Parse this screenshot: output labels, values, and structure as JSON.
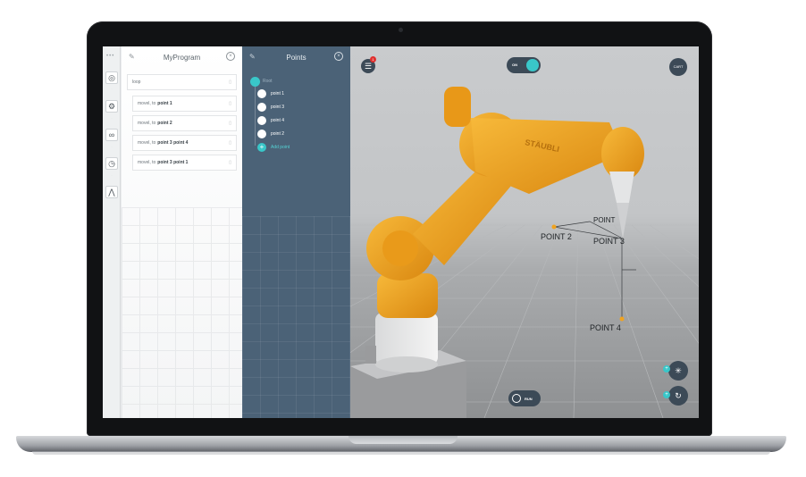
{
  "program": {
    "title": "MyProgram",
    "loop_label": "loop",
    "rows": [
      {
        "prefix": "movel, to",
        "target": "point 1"
      },
      {
        "prefix": "movel, to",
        "target": "point 2"
      },
      {
        "prefix": "movel, to",
        "target": "point 3 point 4"
      },
      {
        "prefix": "movel, to",
        "target": "point 3 point 1"
      }
    ]
  },
  "points_panel": {
    "title": "Points",
    "root_label": "Root",
    "items": [
      "point 1",
      "point 3",
      "point 4",
      "point 2"
    ],
    "add_label": "Add point"
  },
  "viewport": {
    "notification_count": "1",
    "toggle_label": "ON",
    "cart_label": "CART",
    "run_label": "RUN",
    "robot_brand": "STÄUBLI",
    "point_labels": [
      "POINT",
      "POINT 2",
      "POINT 3",
      "POINT 4"
    ]
  },
  "icons": [
    "rail-dots-icon",
    "target-icon",
    "robot-icon",
    "loop-icon",
    "timer-icon",
    "branch-icon",
    "pencil-icon",
    "close-icon",
    "menu-icon",
    "power-icon",
    "axes-icon",
    "rotate-icon"
  ],
  "colors": {
    "accent": "#39c7c9",
    "panel_dark": "#4b6277",
    "button_dark": "#3c4a57",
    "robot_orange": "#f0a320",
    "badge_red": "#e0302e"
  }
}
